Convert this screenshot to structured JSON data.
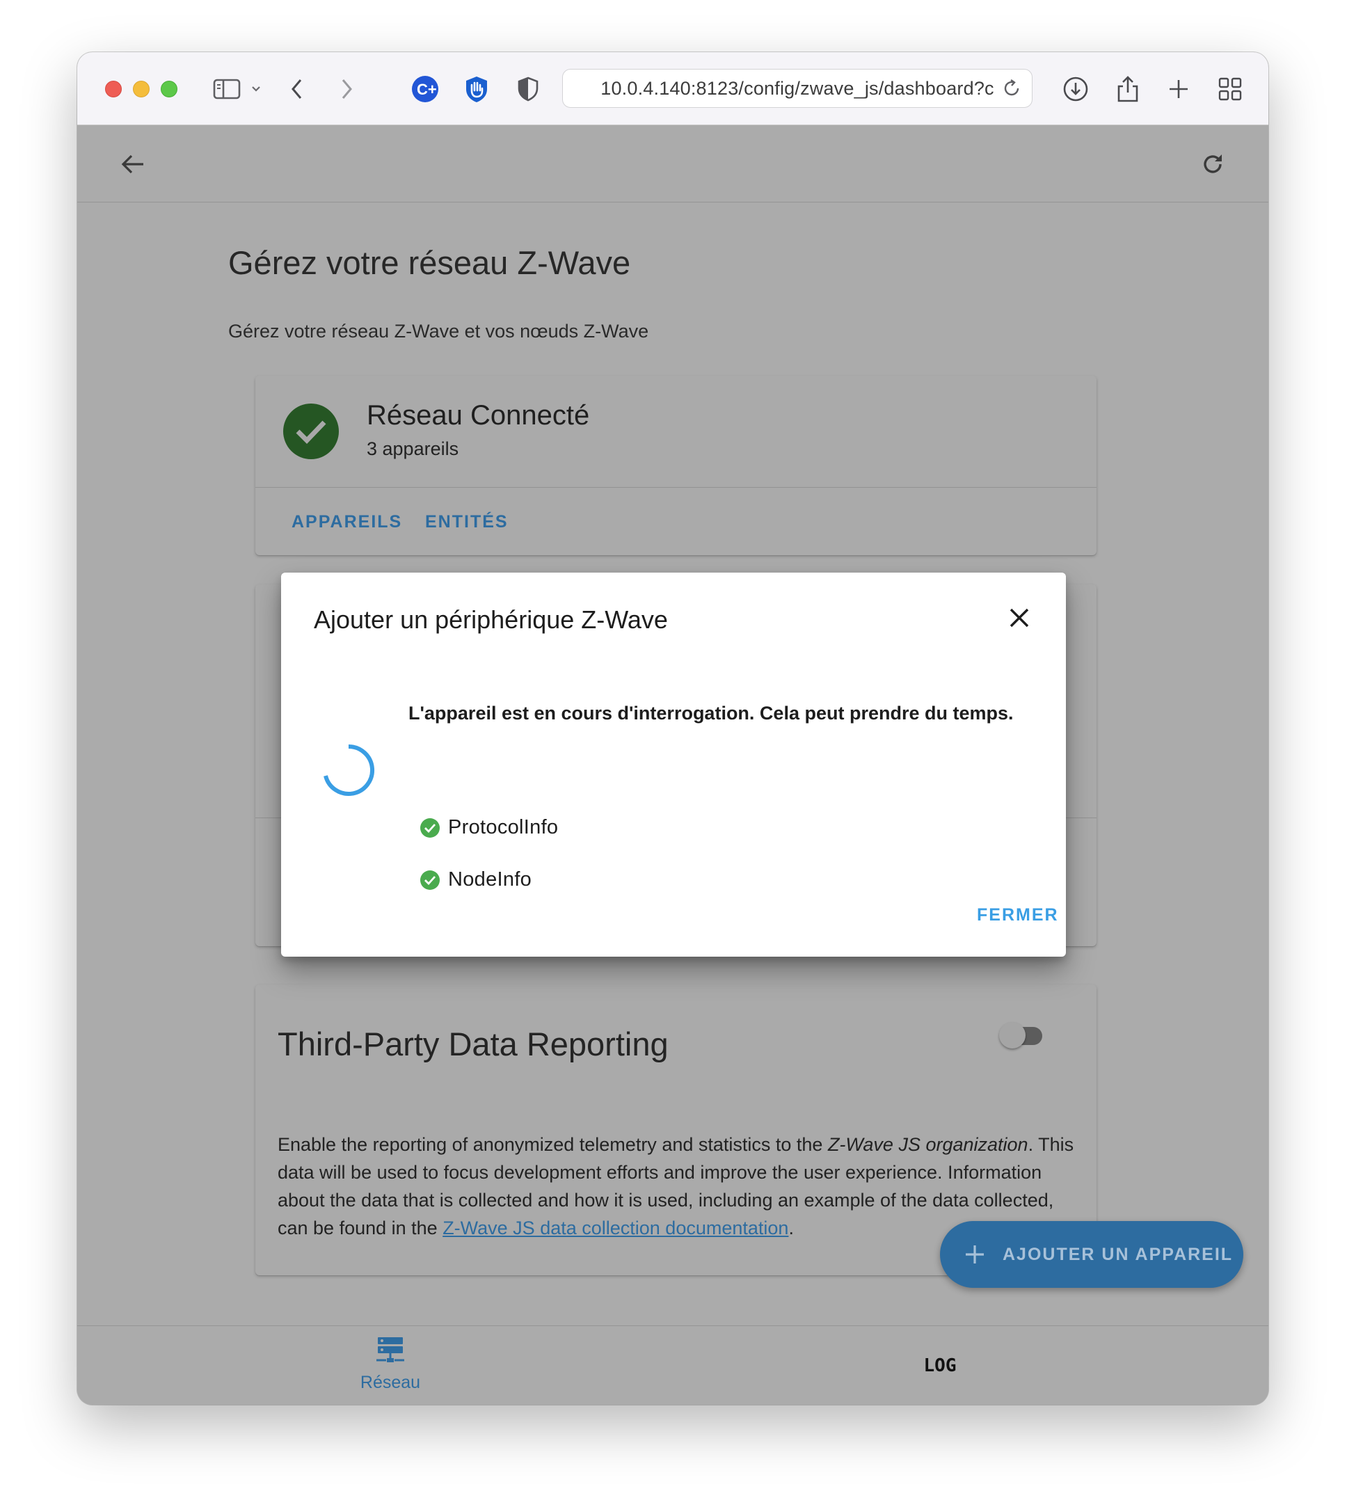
{
  "browser": {
    "url": "10.0.4.140:8123/config/zwave_js/dashboard?c"
  },
  "page": {
    "title": "Gérez votre réseau Z-Wave",
    "subtitle": "Gérez votre réseau Z-Wave et vos nœuds Z-Wave"
  },
  "network_card": {
    "status": "Réseau Connecté",
    "device_count": "3 appareils",
    "actions": [
      "APPAREILS",
      "ENTITÉS"
    ]
  },
  "third_party_card": {
    "title": "Third-Party Data Reporting",
    "toggle_on": false,
    "text_before": "Enable the reporting of anonymized telemetry and statistics to the ",
    "text_emphasis": "Z-Wave JS organization",
    "text_middle": ". This data will be used to focus development efforts and improve the user experience. Information about the data that is collected and how it is used, including an example of the data collected, can be found in the ",
    "link": "Z-Wave JS data collection documentation",
    "text_after": "."
  },
  "fab": {
    "label": "AJOUTER UN APPAREIL"
  },
  "bottom_nav": {
    "network_label": "Réseau",
    "log_label": "LOG"
  },
  "dialog": {
    "title": "Ajouter un périphérique Z-Wave",
    "message": "L'appareil est en cours d'interrogation. Cela peut prendre du temps.",
    "steps": [
      "ProtocolInfo",
      "NodeInfo"
    ],
    "close_label": "FERMER"
  },
  "colors": {
    "accent": "#2d6ca0",
    "dialog_accent": "#3a9ee4",
    "success": "#4aab4e",
    "connected": "#255623",
    "scrim": "#ababab"
  },
  "icons": [
    "sidebar-icon",
    "chevron-down-icon",
    "back-icon",
    "forward-icon",
    "extension-c-icon",
    "extension-hand-icon",
    "shield-icon",
    "reload-icon",
    "download-icon",
    "share-icon",
    "plus-icon",
    "tabs-grid-icon",
    "arrow-left-icon",
    "refresh-icon",
    "check-icon",
    "close-icon",
    "server-network-icon"
  ]
}
